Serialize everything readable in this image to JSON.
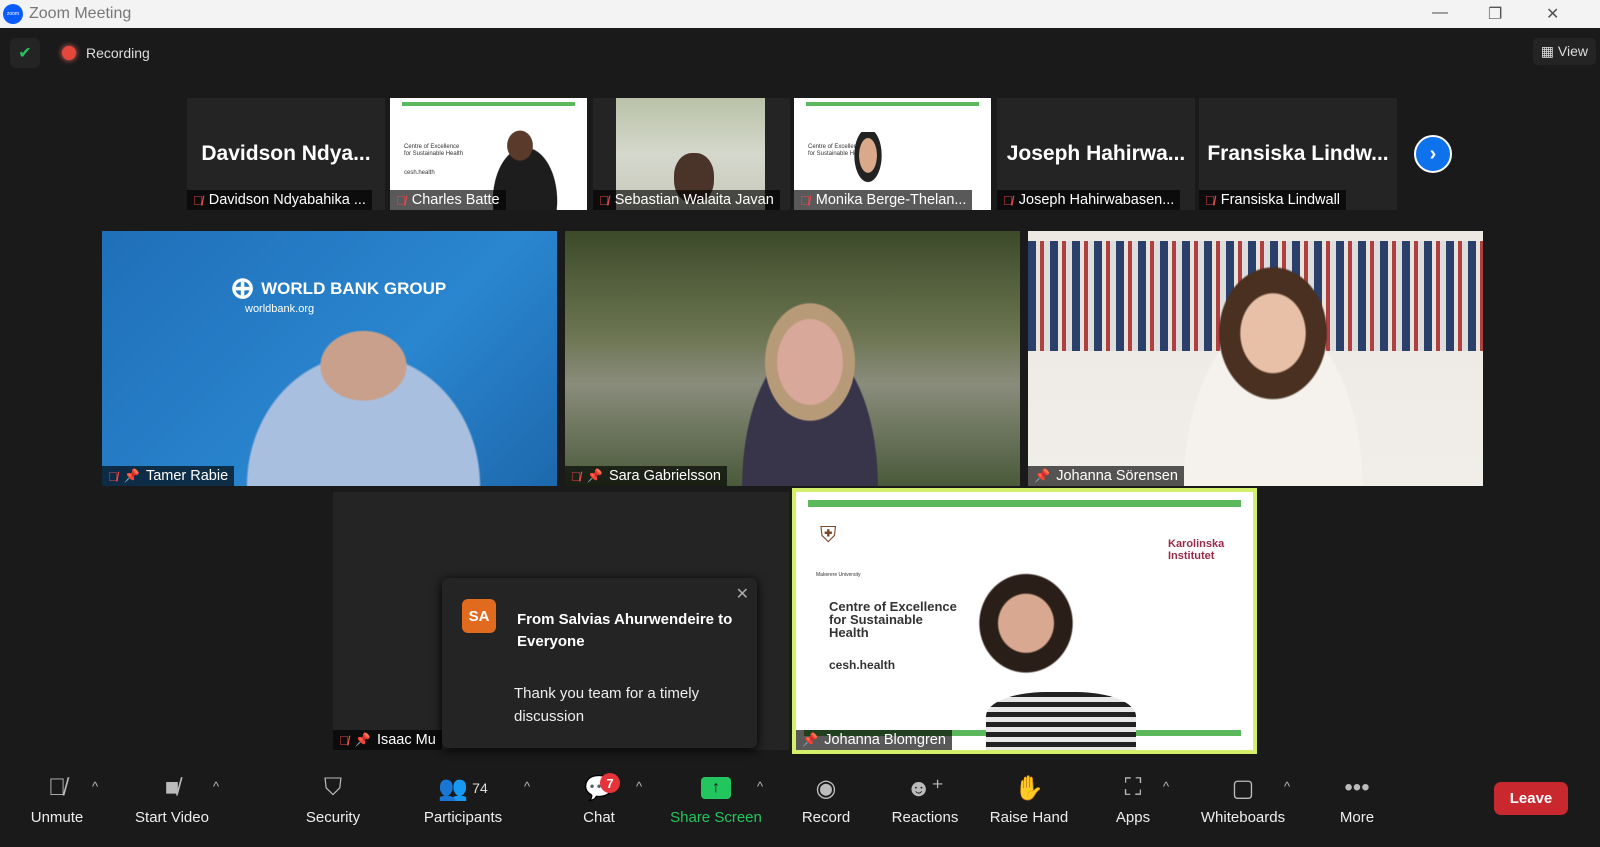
{
  "window": {
    "title": "Zoom Meeting",
    "minimize": "—",
    "restore": "❐",
    "close": "✕"
  },
  "status": {
    "recording": "Recording",
    "view": "View"
  },
  "strip": [
    {
      "big": "Davidson  Ndya...",
      "label": "Davidson Ndyabahika ...",
      "video": false
    },
    {
      "label": "Charles Batte",
      "video": true
    },
    {
      "label": "Sebastian Walaita Javan",
      "video": true
    },
    {
      "label": "Monika Berge-Thelan...",
      "video": true
    },
    {
      "big": "Joseph  Hahirwa...",
      "label": "Joseph Hahirwabasen...",
      "video": false
    },
    {
      "big": "Fransiska  Lindw...",
      "label": "Fransiska Lindwall",
      "video": false
    }
  ],
  "slide": {
    "title": "Centre of Excellence for Sustainable Health",
    "site": "cesh.health",
    "uni": "Makerere University",
    "ki": "Karolinska Institutet"
  },
  "worldbank": {
    "name": "WORLD BANK GROUP",
    "site": "worldbank.org"
  },
  "gallery": [
    {
      "label": "Tamer Rabie",
      "muted": true
    },
    {
      "label": "Sara Gabrielsson",
      "muted": true
    },
    {
      "label": "Johanna Sörensen",
      "muted": false
    },
    {
      "label": "Isaac Mu",
      "muted": true
    },
    {
      "label": "Johanna Blomgren",
      "muted": false,
      "active": true
    }
  ],
  "chat": {
    "initials": "SA",
    "from": "From Salvias Ahurwendeire to Everyone",
    "message": "Thank you team for a timely discussion",
    "close": "✕"
  },
  "toolbar": {
    "unmute": "Unmute",
    "start_video": "Start Video",
    "security": "Security",
    "participants": "Participants",
    "participant_count": "74",
    "chat": "Chat",
    "chat_badge": "7",
    "share": "Share Screen",
    "record": "Record",
    "reactions": "Reactions",
    "raise_hand": "Raise Hand",
    "apps": "Apps",
    "whiteboards": "Whiteboards",
    "more": "More",
    "leave": "Leave"
  },
  "colors": {
    "accent": "#0e72ed",
    "share": "#23c55e",
    "leave": "#c8282e",
    "active_border": "#d4f06a"
  }
}
